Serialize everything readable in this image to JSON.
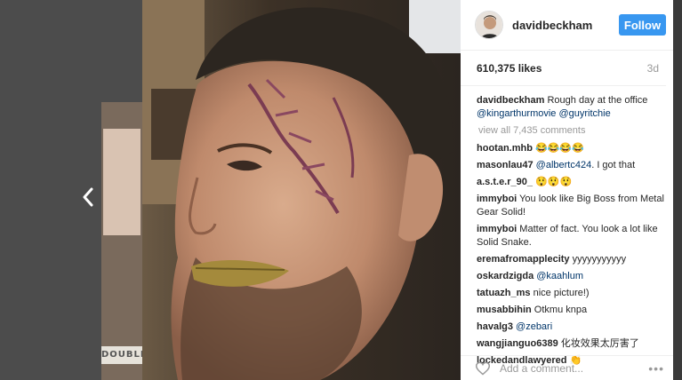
{
  "post": {
    "username": "davidbeckham",
    "follow_label": "Follow",
    "likes": "610,375 likes",
    "age": "3d",
    "caption": {
      "username": "davidbeckham",
      "text": "Rough day at the office",
      "mentions": "@kingarthurmovie @guyritchie"
    },
    "view_all": "view all 7,435 comments",
    "comments": [
      {
        "user": "hootan.mhb",
        "text": "😂😂😂😂"
      },
      {
        "user": "masonlau47",
        "mention": "@albertc424",
        "text": ". I got that"
      },
      {
        "user": "a.s.t.e.r_90_",
        "text": "😲😲😲"
      },
      {
        "user": "immyboi",
        "text": "You look like Big Boss from Metal Gear Solid!"
      },
      {
        "user": "immyboi",
        "text": "Matter of fact. You look a lot like Solid Snake."
      },
      {
        "user": "eremafromapplecity",
        "text": "yyyyyyyyyyу"
      },
      {
        "user": "oskardzigda",
        "mention": "@kaahlum",
        "text": ""
      },
      {
        "user": "tatuazh_ms",
        "text": "nice picture!)"
      },
      {
        "user": "musabbihin",
        "text": "Otkmu knpa"
      },
      {
        "user": "havalg3",
        "mention": "@zebari",
        "text": ""
      },
      {
        "user": "wangjianguo6389",
        "text": "化妆效果太厉害了"
      },
      {
        "user": "lockedandlawyered",
        "text": "👏"
      }
    ],
    "add_comment_placeholder": "Add a comment...",
    "more_label": "•••",
    "side_label": "DOUBLE"
  },
  "icons": {
    "prev": "chevron-left-icon",
    "like": "heart-icon",
    "more": "more-options-icon"
  }
}
